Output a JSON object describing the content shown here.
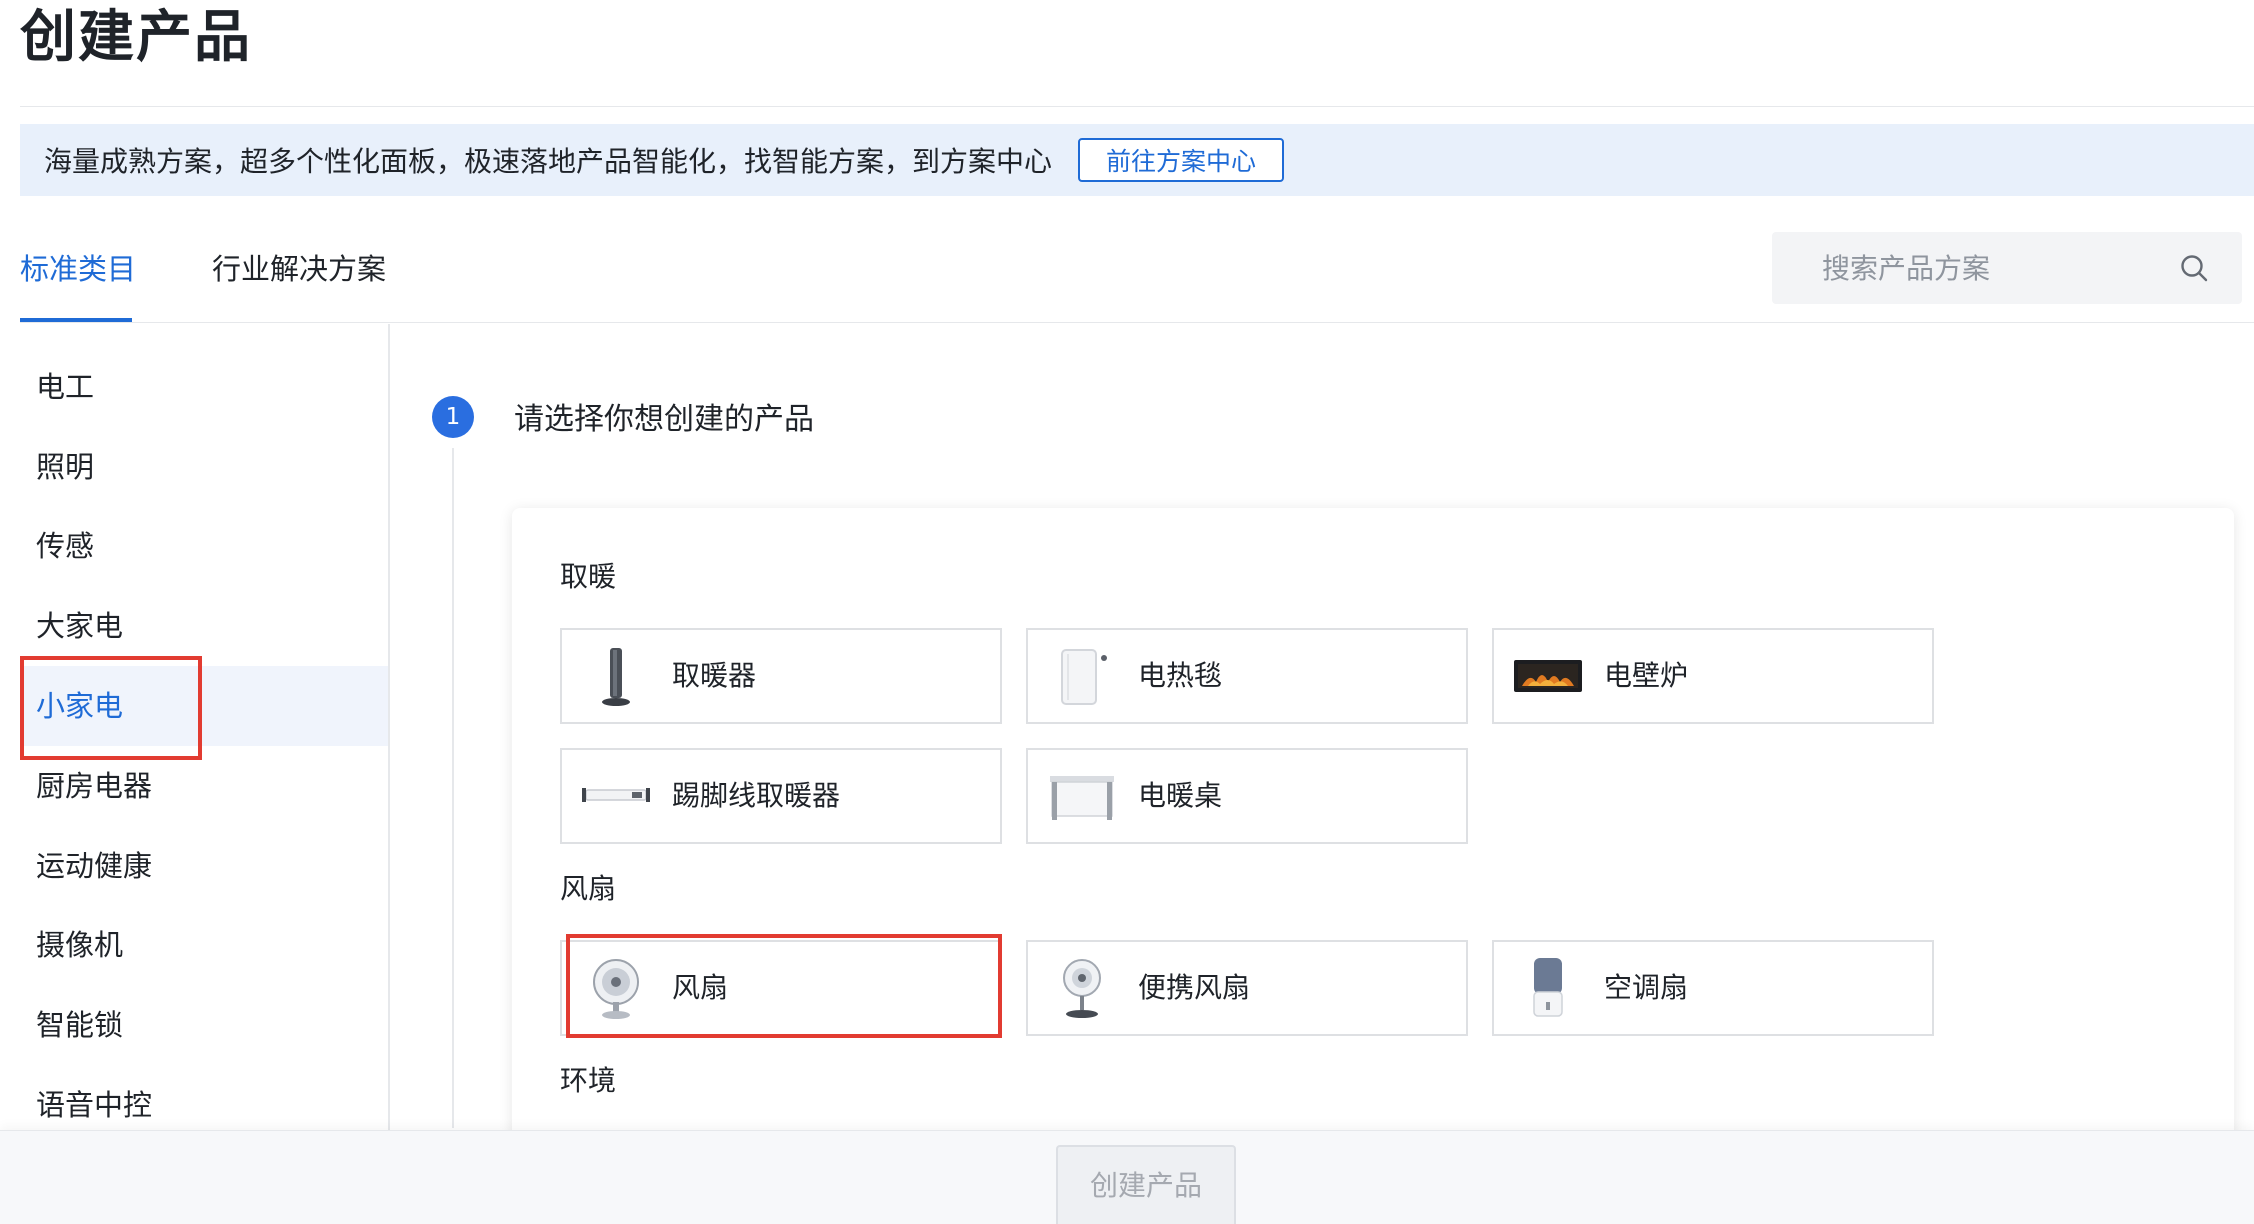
{
  "page": {
    "title": "创建产品"
  },
  "banner": {
    "text": "海量成熟方案，超多个性化面板，极速落地产品智能化，找智能方案，到方案中心",
    "button": "前往方案中心"
  },
  "tabs": [
    {
      "label": "标准类目",
      "active": true
    },
    {
      "label": "行业解决方案",
      "active": false
    }
  ],
  "search": {
    "placeholder": "搜索产品方案",
    "value": ""
  },
  "sidebar": {
    "items": [
      {
        "label": "电工"
      },
      {
        "label": "照明"
      },
      {
        "label": "传感"
      },
      {
        "label": "大家电"
      },
      {
        "label": "小家电",
        "active": true
      },
      {
        "label": "厨房电器"
      },
      {
        "label": "运动健康"
      },
      {
        "label": "摄像机"
      },
      {
        "label": "智能锁"
      },
      {
        "label": "语音中控"
      }
    ]
  },
  "step": {
    "number": "1",
    "title": "请选择你想创建的产品"
  },
  "groups": [
    {
      "label": "取暖",
      "items": [
        {
          "label": "取暖器",
          "icon": "heater-icon"
        },
        {
          "label": "电热毯",
          "icon": "electric-blanket-icon"
        },
        {
          "label": "电壁炉",
          "icon": "electric-fireplace-icon"
        },
        {
          "label": "踢脚线取暖器",
          "icon": "baseboard-heater-icon"
        },
        {
          "label": "电暖桌",
          "icon": "heating-table-icon"
        }
      ]
    },
    {
      "label": "风扇",
      "items": [
        {
          "label": "风扇",
          "icon": "fan-icon",
          "highlighted": true
        },
        {
          "label": "便携风扇",
          "icon": "portable-fan-icon"
        },
        {
          "label": "空调扇",
          "icon": "air-cooler-icon"
        }
      ]
    },
    {
      "label": "环境",
      "items": []
    }
  ],
  "footer": {
    "create_button": "创建产品",
    "create_enabled": false
  },
  "colors": {
    "accent": "#1f6bd6",
    "highlight": "#e23b31",
    "banner_bg": "#e8f0fb"
  }
}
